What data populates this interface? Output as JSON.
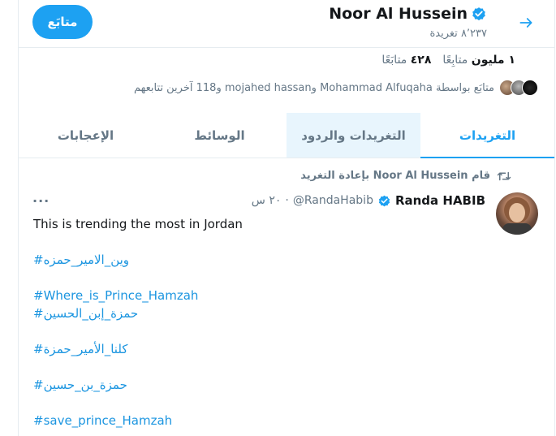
{
  "header": {
    "display_name": "Noor Al Hussein",
    "tweet_count": "٨٬٢٣٧ تغريدة",
    "follow_label": "متابَع"
  },
  "stats": {
    "following_num": "٤٢٨",
    "following_label": "متابَعًا",
    "followers_num": "١ مليون",
    "followers_label": "متابِعًا"
  },
  "followed_by": "متابَع بواسطة Mohammad Alfuqaha وmojahed hassan و118 آخرين تتابعهم",
  "tabs": [
    {
      "label": "التغريدات",
      "active": true
    },
    {
      "label": "التغريدات والردود",
      "active": false
    },
    {
      "label": "الوسائط",
      "active": false
    },
    {
      "label": "الإعجابات",
      "active": false
    }
  ],
  "retweet": {
    "text": "قام Noor Al Hussein بإعادة التغريد"
  },
  "tweet": {
    "name": "Randa HABIB",
    "handle": "@RandaHabib",
    "separator": "·",
    "time": "٢٠ س",
    "more": "···",
    "lines": [
      "This is trending the most in Jordan",
      "#وين_الامير_حمزه",
      "#Where_is_Prince_Hamzah",
      "#حمزة_إبن_الحسين",
      "#كلنا_الأمير_حمزة",
      "#حمزة_بن_حسين",
      "#save_prince_Hamzah"
    ]
  },
  "colors": {
    "accent": "#1da1f2",
    "hashtag": "#1b95e0",
    "muted": "#657786",
    "tab_hover_bg": "#e8f5fd"
  },
  "icons": [
    "back-arrow-icon",
    "verified-badge-icon",
    "retweet-icon",
    "more-icon"
  ]
}
